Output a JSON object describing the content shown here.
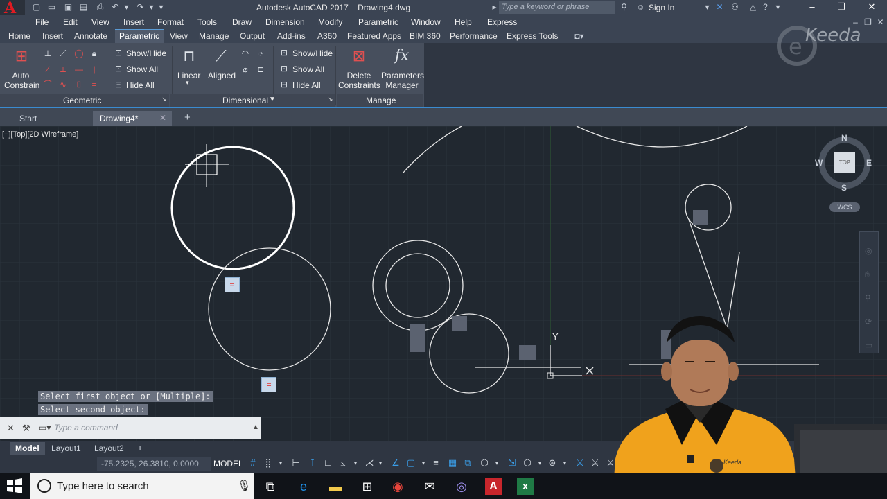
{
  "title_bar": {
    "title": "Autodesk AutoCAD 2017    Drawing4.dwg",
    "search_placeholder": "Type a keyword or phrase",
    "sign_in": "Sign In",
    "app_letter": "A"
  },
  "menu": [
    "File",
    "Edit",
    "View",
    "Insert",
    "Format",
    "Tools",
    "Draw",
    "Dimension",
    "Modify",
    "Parametric",
    "Window",
    "Help",
    "Express"
  ],
  "ribbon_tabs": [
    "Home",
    "Insert",
    "Annotate",
    "Parametric",
    "View",
    "Manage",
    "Output",
    "Add-ins",
    "A360",
    "Featured Apps",
    "BIM 360",
    "Performance",
    "Express Tools"
  ],
  "active_ribbon_tab": "Parametric",
  "ribbon": {
    "auto_constrain": "Auto\nConstrain",
    "geo_show_hide": "Show/Hide",
    "geo_show_all": "Show All",
    "geo_hide_all": "Hide All",
    "linear": "Linear",
    "aligned": "Aligned",
    "dim_show_hide": "Show/Hide",
    "dim_show_all": "Show All",
    "dim_hide_all": "Hide All",
    "delete_constraints": "Delete\nConstraints",
    "parameters_manager": "Parameters\nManager",
    "fx": "fx",
    "panel_geometric": "Geometric",
    "panel_dimensional": "Dimensional",
    "panel_manage": "Manage"
  },
  "file_tabs": {
    "start": "Start",
    "drawing": "Drawing4*"
  },
  "viewport": {
    "label": "[−][Top][2D Wireframe]",
    "compass": {
      "n": "N",
      "s": "S",
      "e": "E",
      "w": "W",
      "top": "TOP"
    },
    "wcs": "WCS",
    "ucs_y": "Y",
    "constraint_glyph": "="
  },
  "command": {
    "history": [
      "Select first object or [Multiple]:",
      "Select second object:"
    ],
    "placeholder": "Type a command"
  },
  "layout_tabs": [
    "Model",
    "Layout1",
    "Layout2"
  ],
  "status": {
    "coords": "-75.2325, 26.3810, 0.0000",
    "model": "MODEL"
  },
  "taskbar": {
    "search": "Type here to search"
  },
  "watermark": "Keeda",
  "shirt_logo": "Keeda",
  "colors": {
    "accent": "#3a8bd0",
    "canvas": "#212830",
    "autocad_red": "#e01b22"
  }
}
